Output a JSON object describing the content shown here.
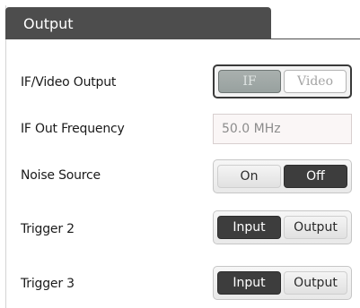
{
  "panel": {
    "title": "Output"
  },
  "rows": {
    "if_video": {
      "label": "IF/Video Output",
      "options": [
        "IF",
        "Video"
      ],
      "selected": "IF",
      "enabled": false
    },
    "if_freq": {
      "label": "IF Out Frequency",
      "value": "50.0 MHz",
      "enabled": false
    },
    "noise_source": {
      "label": "Noise Source",
      "options": [
        "On",
        "Off"
      ],
      "selected": "Off"
    },
    "trigger2": {
      "label": "Trigger 2",
      "options": [
        "Input",
        "Output"
      ],
      "selected": "Input"
    },
    "trigger3": {
      "label": "Trigger 3",
      "options": [
        "Input",
        "Output"
      ],
      "selected": "Input"
    }
  },
  "colors": {
    "tab_bg": "#4d4d4d",
    "selected_bg": "#3d3d3d",
    "disabled_selected_bg": "#a9b0ae"
  }
}
